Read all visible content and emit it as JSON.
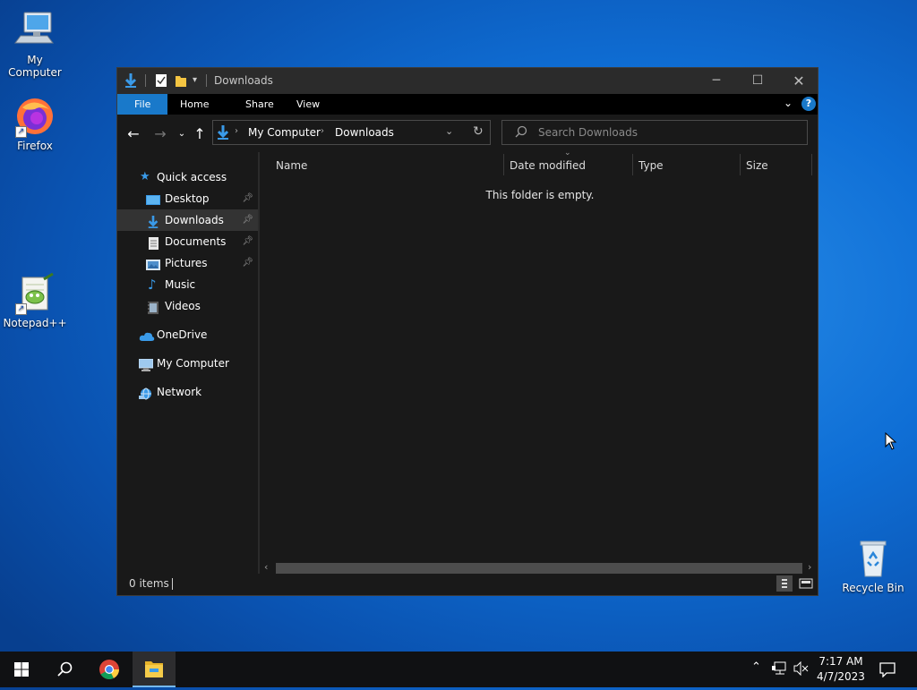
{
  "desktop": {
    "icons": [
      {
        "label": "My Computer"
      },
      {
        "label": "Firefox"
      },
      {
        "label": "Notepad++"
      },
      {
        "label": "Recycle Bin"
      }
    ]
  },
  "window": {
    "title": "Downloads",
    "ribbon_tabs": [
      "File",
      "Home",
      "Share",
      "View"
    ],
    "breadcrumb": [
      "My Computer",
      "Downloads"
    ],
    "search_placeholder": "Search Downloads",
    "nav": {
      "quick_access": "Quick access",
      "items": [
        {
          "label": "Desktop",
          "pinned": true
        },
        {
          "label": "Downloads",
          "pinned": true,
          "selected": true
        },
        {
          "label": "Documents",
          "pinned": true
        },
        {
          "label": "Pictures",
          "pinned": true
        },
        {
          "label": "Music",
          "pinned": false
        },
        {
          "label": "Videos",
          "pinned": false
        }
      ],
      "onedrive": "OneDrive",
      "my_computer": "My Computer",
      "network": "Network"
    },
    "columns": [
      "Name",
      "Date modified",
      "Type",
      "Size"
    ],
    "empty_message": "This folder is empty.",
    "status": "0 items"
  },
  "taskbar": {
    "time": "7:17 AM",
    "date": "4/7/2023"
  },
  "colors": {
    "accent": "#1979ca",
    "window_bg": "#191919",
    "taskbar_bg": "#101113"
  }
}
